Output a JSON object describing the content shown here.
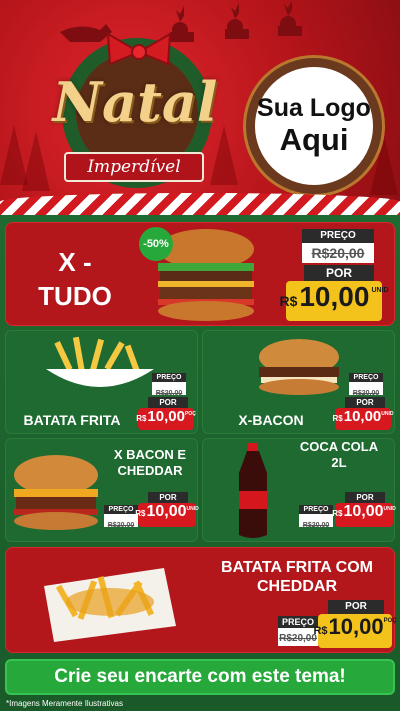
{
  "header": {
    "title": "Natal",
    "subtitle": "Imperdível",
    "logo_line1": "Sua Logo",
    "logo_line2": "Aqui"
  },
  "products": [
    {
      "name": "X - TUDO",
      "price_label": "PREÇO",
      "old_price": "R$20,00",
      "por_label": "POR",
      "currency": "R$",
      "price": "10,00",
      "unit": "UNID",
      "discount": "-50%"
    },
    {
      "name": "BATATA FRITA",
      "price_label": "PREÇO",
      "old_price": "R$20,00",
      "por_label": "POR",
      "currency": "R$",
      "price": "10,00",
      "unit": "POÇ"
    },
    {
      "name": "X-BACON",
      "price_label": "PREÇO",
      "old_price": "R$20,00",
      "por_label": "POR",
      "currency": "R$",
      "price": "10,00",
      "unit": "UNID"
    },
    {
      "name": "X BACON E CHEDDAR",
      "price_label": "PREÇO",
      "old_price": "R$20,00",
      "por_label": "POR",
      "currency": "R$",
      "price": "10,00",
      "unit": "UNID"
    },
    {
      "name": "COCA COLA 2L",
      "price_label": "PREÇO",
      "old_price": "R$20,00",
      "por_label": "POR",
      "currency": "R$",
      "price": "10,00",
      "unit": "UNID"
    },
    {
      "name": "BATATA FRITA COM CHEDDAR",
      "price_label": "PREÇO",
      "old_price": "R$20,00",
      "por_label": "POR",
      "currency": "R$",
      "price": "10,00",
      "unit": "POÇ"
    }
  ],
  "cta": "Crie seu encarte com este tema!",
  "footnote": "*Imagens Meramente Ilustrativas",
  "colors": {
    "red": "#b3161b",
    "green": "#1e6a30",
    "yellow": "#f3c21b",
    "cta_green": "#27a83b"
  }
}
